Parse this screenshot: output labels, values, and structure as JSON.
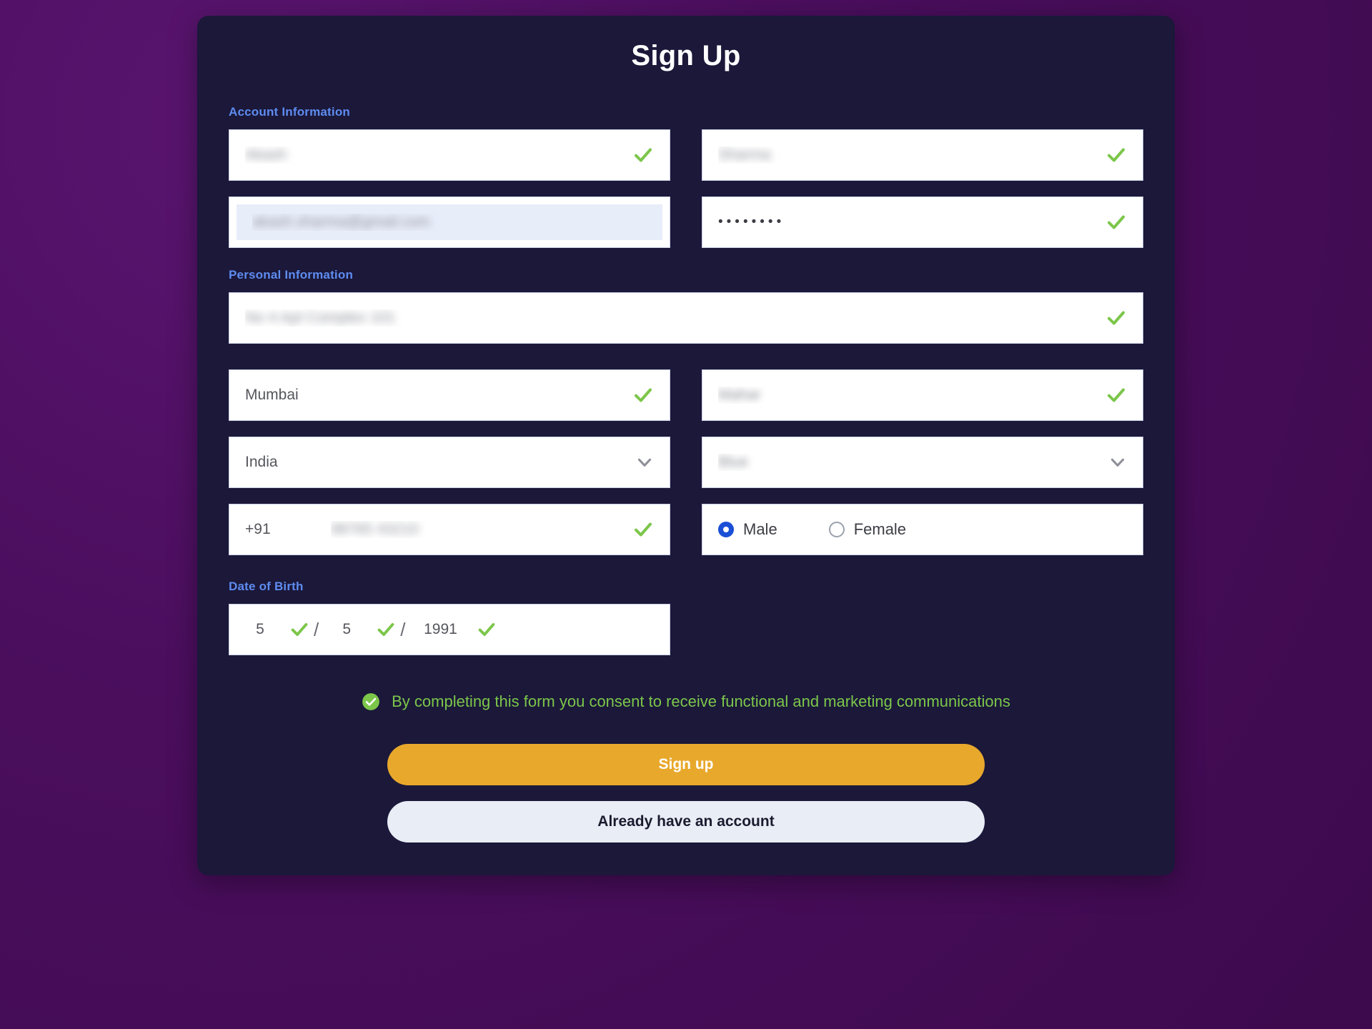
{
  "page": {
    "title": "Sign Up",
    "background_color": "#4a0e5c",
    "card_color": "#1b183a"
  },
  "sections": {
    "account": "Account Information",
    "personal": "Personal Information",
    "dob": "Date of Birth"
  },
  "account_fields": {
    "first_name": {
      "value": "Akash",
      "redacted": true,
      "status": "valid"
    },
    "last_name": {
      "value": "Sharma",
      "redacted": true,
      "status": "valid"
    },
    "email": {
      "value": "akash.sharma@gmail.com",
      "redacted": true,
      "status": "autofilled"
    },
    "password": {
      "value": "••••••••",
      "redacted": false,
      "status": "valid"
    }
  },
  "personal_fields": {
    "address": {
      "value": "No 4 Apt Complex 101",
      "redacted": true,
      "status": "valid"
    },
    "city": {
      "value": "Mumbai",
      "redacted": false,
      "status": "valid"
    },
    "state": {
      "value": "Mahar",
      "redacted": true,
      "status": "valid"
    },
    "country": {
      "value": "India",
      "redacted": false,
      "control": "dropdown"
    },
    "extra_select": {
      "value": "Blue",
      "redacted": true,
      "control": "dropdown"
    },
    "phone": {
      "prefix": "+91",
      "value": "98765 43210",
      "redacted": true,
      "status": "valid"
    }
  },
  "gender": {
    "options": [
      {
        "label": "Male",
        "selected": true
      },
      {
        "label": "Female",
        "selected": false
      }
    ],
    "selected_color": "#1a4fd6"
  },
  "date_of_birth": {
    "day": "5",
    "month": "5",
    "year": "1991",
    "separator": "/",
    "day_valid": true,
    "month_valid": true,
    "year_valid": true
  },
  "consent": {
    "text": "By completing this form you consent to receive functional and marketing communications",
    "checked": true,
    "color": "#7cc64a"
  },
  "buttons": {
    "primary": "Sign up",
    "primary_color": "#e8a82c",
    "secondary": "Already have an account",
    "secondary_color": "#e8edf6"
  },
  "colors": {
    "section_label": "#5e8cf0",
    "check_green": "#7cc64a",
    "autofill_blue": "#e8edfa"
  }
}
